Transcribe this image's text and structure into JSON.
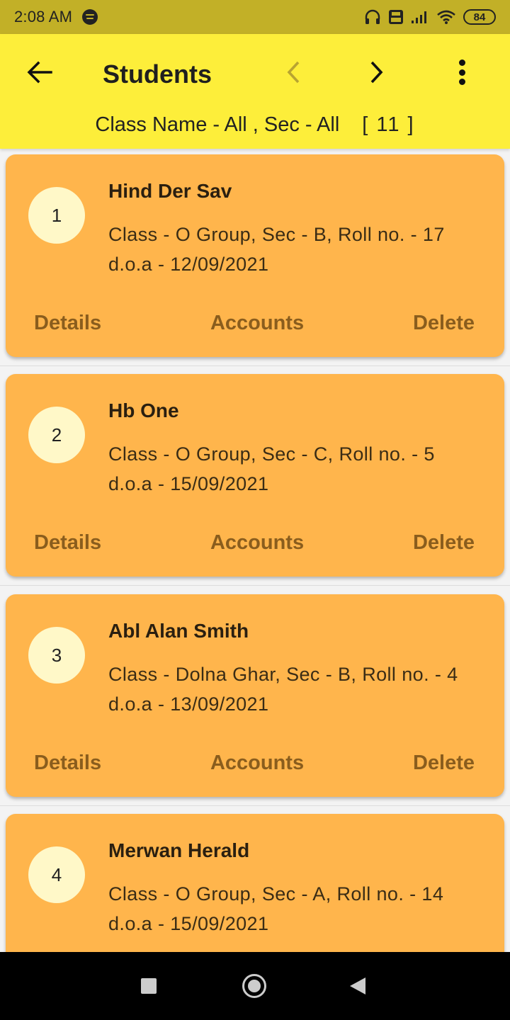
{
  "status_bar": {
    "time": "2:08 AM",
    "battery": "84",
    "icons": [
      "spotify-icon",
      "headset-icon",
      "volte-icon",
      "signal-icon",
      "wifi-icon",
      "battery-icon"
    ]
  },
  "app_bar": {
    "title": "Students",
    "filter_text": "Class Name - All ,  Sec - All",
    "count_text": "[ 11 ]",
    "background": "#fdee3a",
    "icons": [
      "back-arrow-icon",
      "chevron-left-icon",
      "chevron-right-icon",
      "more-vert-icon"
    ]
  },
  "students": [
    {
      "serial": "1",
      "name": "Hind Der Sav",
      "class_line": "Class - O Group, Sec - B, Roll no. - 17",
      "doa_line": "d.o.a - 12/09/2021"
    },
    {
      "serial": "2",
      "name": "Hb One",
      "class_line": "Class - O Group, Sec - C, Roll no. - 5",
      "doa_line": "d.o.a - 15/09/2021"
    },
    {
      "serial": "3",
      "name": "Abl Alan Smith",
      "class_line": "Class - Dolna Ghar, Sec - B, Roll no. - 4",
      "doa_line": "d.o.a - 13/09/2021"
    },
    {
      "serial": "4",
      "name": "Merwan Herald",
      "class_line": "Class - O Group, Sec - A, Roll no. - 14",
      "doa_line": "d.o.a - 15/09/2021"
    }
  ],
  "card_actions": {
    "details": "Details",
    "accounts": "Accounts",
    "delete": "Delete"
  },
  "colors": {
    "status_bar": "#c2b027",
    "card": "#ffb54c",
    "badge": "#fff8c8",
    "action_text": "#8a5d1d"
  },
  "nav_bar": {
    "icons": [
      "recents-square-icon",
      "home-circle-icon",
      "back-triangle-icon"
    ]
  }
}
